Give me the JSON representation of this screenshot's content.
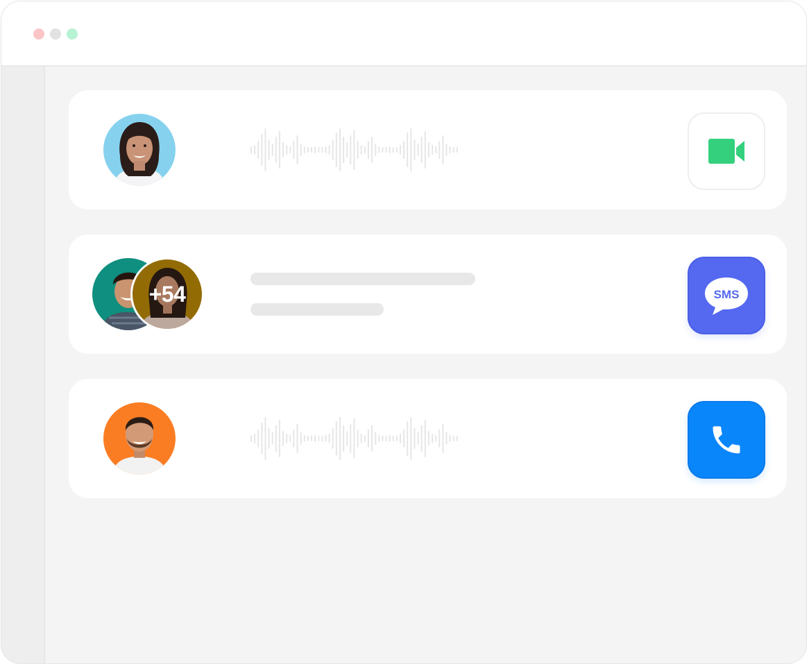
{
  "window": {
    "controls": [
      {
        "name": "close",
        "color": "#fbc5c5"
      },
      {
        "name": "minimize",
        "color": "#e2e2e2"
      },
      {
        "name": "maximize",
        "color": "#b7f3d4"
      }
    ]
  },
  "conversations": [
    {
      "kind": "voice-message",
      "avatar_bg": "#7fcdea",
      "action": {
        "icon": "video-camera-icon",
        "color": "#34d07e"
      }
    },
    {
      "kind": "group-text",
      "avatar_bg": "#0f8f7f",
      "overlay_bg": "#a87a06",
      "group_count_label": "+54",
      "action": {
        "icon": "sms-bubble-icon",
        "label": "SMS",
        "color": "#5468f0"
      }
    },
    {
      "kind": "voice-call",
      "avatar_bg": "#fb7d23",
      "action": {
        "icon": "phone-icon",
        "color": "#0a86fb"
      }
    }
  ]
}
